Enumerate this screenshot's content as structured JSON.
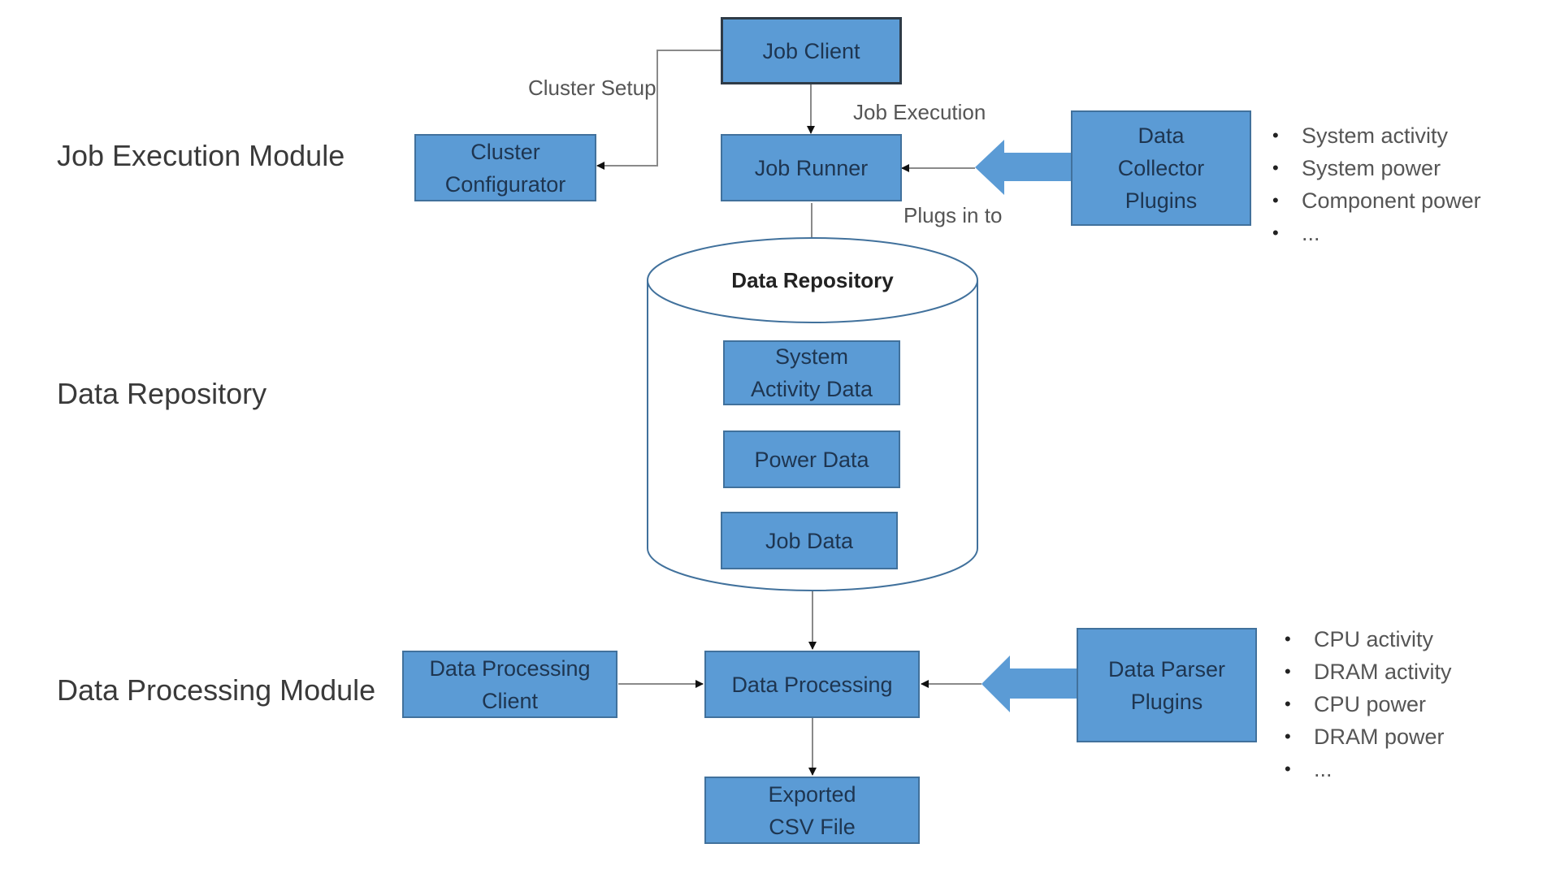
{
  "colors": {
    "box_fill": "#5b9bd5",
    "box_border": "#41719c",
    "box_text": "#1e3550",
    "connector": "#8a8a8a",
    "cylinder_stroke": "#41719c",
    "label_text": "#3a3a3a"
  },
  "sections": {
    "job_execution": "Job Execution Module",
    "data_repository": "Data Repository",
    "data_processing": "Data Processing Module"
  },
  "nodes": {
    "job_client": "Job Client",
    "cluster_configurator": "Cluster\nConfigurator",
    "job_runner": "Job Runner",
    "data_collector_plugins": "Data\nCollector\nPlugins",
    "repository_title": "Data Repository",
    "system_activity_data": "System\nActivity Data",
    "power_data": "Power Data",
    "job_data": "Job Data",
    "data_processing_client": "Data Processing\nClient",
    "data_processing": "Data Processing",
    "data_parser_plugins": "Data Parser\nPlugins",
    "exported_csv": "Exported\nCSV File"
  },
  "edges": {
    "cluster_setup": "Cluster Setup",
    "job_execution": "Job Execution",
    "plugs_in_to": "Plugs in to"
  },
  "collector_items": [
    "System activity",
    "System power",
    "Component power",
    "..."
  ],
  "parser_items": [
    "CPU activity",
    "DRAM activity",
    "CPU power",
    "DRAM power",
    "..."
  ],
  "connections": [
    {
      "from": "Job Client",
      "to": "Cluster Configurator",
      "label": "Cluster Setup"
    },
    {
      "from": "Job Client",
      "to": "Job Runner",
      "label": "Job Execution"
    },
    {
      "from": "Data Collector Plugins",
      "to": "Job Runner",
      "label": "Plugs in to"
    },
    {
      "from": "Job Runner",
      "to": "Data Repository"
    },
    {
      "from": "Data Repository",
      "to": "Data Processing"
    },
    {
      "from": "Data Processing Client",
      "to": "Data Processing"
    },
    {
      "from": "Data Parser Plugins",
      "to": "Data Processing"
    },
    {
      "from": "Data Processing",
      "to": "Exported CSV File"
    }
  ]
}
